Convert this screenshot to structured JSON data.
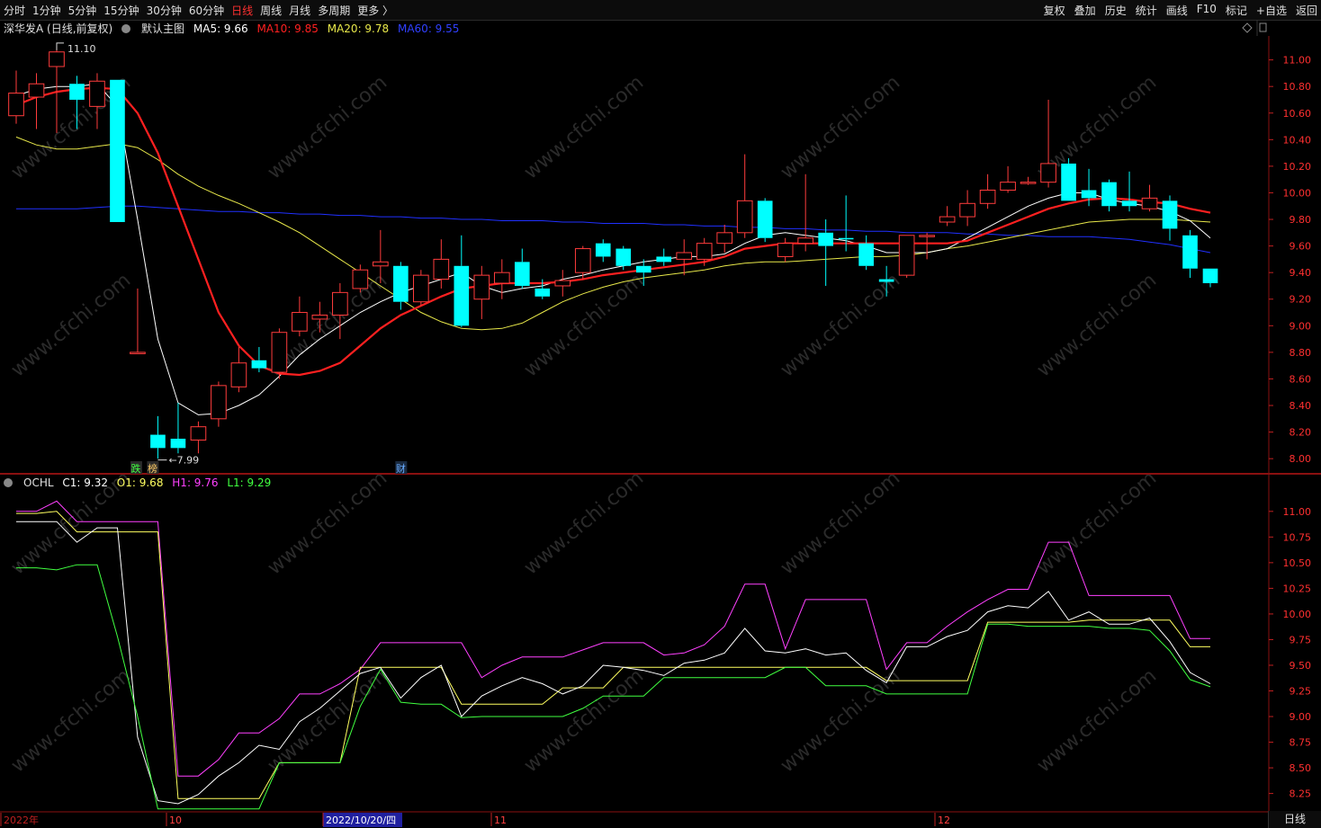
{
  "toolbar": {
    "left": [
      "分时",
      "1分钟",
      "5分钟",
      "15分钟",
      "30分钟",
      "60分钟",
      "日线",
      "周线",
      "月线",
      "多周期",
      "更多 〉"
    ],
    "active_index": 6,
    "right": [
      "复权",
      "叠加",
      "历史",
      "统计",
      "画线",
      "F10",
      "标记",
      "+自选",
      "返回"
    ]
  },
  "main_legend": {
    "stock": "深华发A (日线,前复权)",
    "template": "默认主图",
    "ma5": "MA5: 9.66",
    "ma10": "MA10: 9.85",
    "ma20": "MA20: 9.78",
    "ma60": "MA60: 9.55"
  },
  "sub_legend": {
    "name": "OCHL",
    "c1": "C1: 9.32",
    "o1": "O1: 9.68",
    "h1": "H1: 9.76",
    "l1": "L1: 9.29"
  },
  "bottom_right_label": "日线",
  "colors": {
    "up": "#ff3c3c",
    "down": "#00ffff",
    "ma5": "#ffffff",
    "ma10": "#ff2020",
    "ma20": "#e8e84a",
    "ma60": "#2030ff",
    "h1": "#ff40ff",
    "o1": "#ffff60",
    "c1": "#ffffff",
    "l1": "#40ff40",
    "axis": "#ff3030",
    "watermark": "#262626"
  },
  "watermark": "www.cfchi.com",
  "chart_data": [
    {
      "type": "candlestick",
      "title": "深华发A (日线,前复权)",
      "ylim": [
        7.92,
        11.18
      ],
      "y_ticks": [
        "11.00",
        "10.80",
        "10.60",
        "10.40",
        "10.20",
        "10.00",
        "9.80",
        "9.60",
        "9.40",
        "9.20",
        "9.00",
        "8.80",
        "8.60",
        "8.40",
        "8.20",
        "8.00"
      ],
      "max_marker": "11.10",
      "min_marker": "7.99",
      "event_tags": [
        "跌",
        "榜",
        "财"
      ],
      "candles": [
        {
          "o": 10.58,
          "c": 10.75,
          "h": 10.92,
          "l": 10.52
        },
        {
          "o": 10.72,
          "c": 10.82,
          "h": 10.9,
          "l": 10.48
        },
        {
          "o": 10.95,
          "c": 11.06,
          "h": 11.1,
          "l": 10.45
        },
        {
          "o": 10.82,
          "c": 10.7,
          "h": 10.88,
          "l": 10.48
        },
        {
          "o": 10.65,
          "c": 10.84,
          "h": 10.9,
          "l": 10.48
        },
        {
          "o": 10.85,
          "c": 9.78,
          "h": 10.85,
          "l": 9.78
        },
        {
          "o": 8.8,
          "c": 8.8,
          "h": 9.28,
          "l": 8.8
        },
        {
          "o": 8.18,
          "c": 8.08,
          "h": 8.32,
          "l": 8.0
        },
        {
          "o": 8.15,
          "c": 8.08,
          "h": 8.42,
          "l": 8.04
        },
        {
          "o": 8.14,
          "c": 8.24,
          "h": 8.28,
          "l": 8.04
        },
        {
          "o": 8.3,
          "c": 8.55,
          "h": 8.58,
          "l": 8.24
        },
        {
          "o": 8.54,
          "c": 8.72,
          "h": 8.84,
          "l": 8.5
        },
        {
          "o": 8.74,
          "c": 8.68,
          "h": 8.84,
          "l": 8.65
        },
        {
          "o": 8.65,
          "c": 8.95,
          "h": 8.98,
          "l": 8.6
        },
        {
          "o": 8.96,
          "c": 9.1,
          "h": 9.22,
          "l": 8.92
        },
        {
          "o": 9.05,
          "c": 9.08,
          "h": 9.18,
          "l": 8.95
        },
        {
          "o": 9.08,
          "c": 9.25,
          "h": 9.32,
          "l": 8.9
        },
        {
          "o": 9.28,
          "c": 9.42,
          "h": 9.46,
          "l": 9.25
        },
        {
          "o": 9.45,
          "c": 9.48,
          "h": 9.72,
          "l": 9.32
        },
        {
          "o": 9.45,
          "c": 9.18,
          "h": 9.48,
          "l": 9.12
        },
        {
          "o": 9.18,
          "c": 9.38,
          "h": 9.42,
          "l": 9.15
        },
        {
          "o": 9.35,
          "c": 9.5,
          "h": 9.65,
          "l": 9.28
        },
        {
          "o": 9.45,
          "c": 9.0,
          "h": 9.68,
          "l": 8.99
        },
        {
          "o": 9.2,
          "c": 9.38,
          "h": 9.45,
          "l": 9.05
        },
        {
          "o": 9.32,
          "c": 9.4,
          "h": 9.5,
          "l": 9.2
        },
        {
          "o": 9.48,
          "c": 9.3,
          "h": 9.58,
          "l": 9.28
        },
        {
          "o": 9.28,
          "c": 9.22,
          "h": 9.35,
          "l": 9.2
        },
        {
          "o": 9.3,
          "c": 9.34,
          "h": 9.42,
          "l": 9.22
        },
        {
          "o": 9.4,
          "c": 9.58,
          "h": 9.6,
          "l": 9.35
        },
        {
          "o": 9.62,
          "c": 9.52,
          "h": 9.65,
          "l": 9.48
        },
        {
          "o": 9.58,
          "c": 9.45,
          "h": 9.6,
          "l": 9.42
        },
        {
          "o": 9.45,
          "c": 9.4,
          "h": 9.5,
          "l": 9.3
        },
        {
          "o": 9.52,
          "c": 9.48,
          "h": 9.58,
          "l": 9.45
        },
        {
          "o": 9.5,
          "c": 9.55,
          "h": 9.65,
          "l": 9.38
        },
        {
          "o": 9.5,
          "c": 9.62,
          "h": 9.66,
          "l": 9.45
        },
        {
          "o": 9.62,
          "c": 9.7,
          "h": 9.76,
          "l": 9.55
        },
        {
          "o": 9.7,
          "c": 9.94,
          "h": 10.29,
          "l": 9.66
        },
        {
          "o": 9.94,
          "c": 9.66,
          "h": 9.96,
          "l": 9.63
        },
        {
          "o": 9.52,
          "c": 9.62,
          "h": 9.66,
          "l": 9.48
        },
        {
          "o": 9.62,
          "c": 9.66,
          "h": 10.14,
          "l": 9.56
        },
        {
          "o": 9.7,
          "c": 9.6,
          "h": 9.8,
          "l": 9.3
        },
        {
          "o": 9.66,
          "c": 9.65,
          "h": 9.98,
          "l": 9.56
        },
        {
          "o": 9.62,
          "c": 9.45,
          "h": 9.68,
          "l": 9.42
        },
        {
          "o": 9.35,
          "c": 9.33,
          "h": 9.45,
          "l": 9.22
        },
        {
          "o": 9.38,
          "c": 9.68,
          "h": 9.68,
          "l": 9.36
        },
        {
          "o": 9.67,
          "c": 9.68,
          "h": 9.7,
          "l": 9.5
        },
        {
          "o": 9.78,
          "c": 9.82,
          "h": 9.9,
          "l": 9.75
        },
        {
          "o": 9.82,
          "c": 9.92,
          "h": 10.02,
          "l": 9.75
        },
        {
          "o": 9.92,
          "c": 10.02,
          "h": 10.14,
          "l": 9.88
        },
        {
          "o": 10.02,
          "c": 10.08,
          "h": 10.2,
          "l": 10.0
        },
        {
          "o": 10.08,
          "c": 10.08,
          "h": 10.12,
          "l": 10.06
        },
        {
          "o": 10.08,
          "c": 10.22,
          "h": 10.7,
          "l": 10.04
        },
        {
          "o": 10.22,
          "c": 9.94,
          "h": 10.26,
          "l": 9.94
        },
        {
          "o": 10.02,
          "c": 9.96,
          "h": 10.18,
          "l": 9.9
        },
        {
          "o": 10.08,
          "c": 9.9,
          "h": 10.1,
          "l": 9.86
        },
        {
          "o": 9.94,
          "c": 9.9,
          "h": 10.16,
          "l": 9.86
        },
        {
          "o": 9.88,
          "c": 9.96,
          "h": 10.06,
          "l": 9.86
        },
        {
          "o": 9.94,
          "c": 9.73,
          "h": 9.98,
          "l": 9.64
        },
        {
          "o": 9.68,
          "c": 9.43,
          "h": 9.72,
          "l": 9.36
        },
        {
          "o": 9.43,
          "c": 9.32,
          "h": 9.43,
          "l": 9.29
        }
      ],
      "ma5": [
        10.73,
        10.78,
        10.8,
        10.8,
        10.82,
        10.65,
        9.8,
        8.9,
        8.42,
        8.33,
        8.34,
        8.4,
        8.48,
        8.62,
        8.78,
        8.9,
        9.0,
        9.1,
        9.18,
        9.25,
        9.3,
        9.35,
        9.4,
        9.3,
        9.25,
        9.28,
        9.3,
        9.35,
        9.38,
        9.42,
        9.45,
        9.48,
        9.5,
        9.52,
        9.52,
        9.54,
        9.62,
        9.68,
        9.7,
        9.68,
        9.66,
        9.64,
        9.6,
        9.55,
        9.55,
        9.55,
        9.58,
        9.66,
        9.74,
        9.82,
        9.9,
        9.96,
        10.0,
        10.0,
        9.95,
        9.92,
        9.9,
        9.86,
        9.79,
        9.66
      ],
      "ma10": [
        10.66,
        10.72,
        10.76,
        10.78,
        10.79,
        10.78,
        10.6,
        10.3,
        9.9,
        9.5,
        9.1,
        8.85,
        8.7,
        8.64,
        8.63,
        8.66,
        8.72,
        8.85,
        8.98,
        9.08,
        9.15,
        9.22,
        9.28,
        9.3,
        9.32,
        9.32,
        9.32,
        9.33,
        9.35,
        9.38,
        9.4,
        9.42,
        9.44,
        9.46,
        9.48,
        9.52,
        9.58,
        9.6,
        9.62,
        9.62,
        9.62,
        9.62,
        9.62,
        9.62,
        9.62,
        9.62,
        9.62,
        9.64,
        9.7,
        9.76,
        9.82,
        9.88,
        9.92,
        9.95,
        9.96,
        9.95,
        9.93,
        9.92,
        9.88,
        9.85
      ],
      "ma20": [
        10.42,
        10.36,
        10.33,
        10.33,
        10.35,
        10.37,
        10.34,
        10.25,
        10.14,
        10.05,
        9.98,
        9.92,
        9.85,
        9.78,
        9.7,
        9.6,
        9.5,
        9.4,
        9.3,
        9.2,
        9.1,
        9.03,
        8.98,
        8.97,
        8.98,
        9.02,
        9.1,
        9.18,
        9.24,
        9.29,
        9.33,
        9.36,
        9.38,
        9.4,
        9.42,
        9.45,
        9.47,
        9.48,
        9.48,
        9.49,
        9.5,
        9.51,
        9.52,
        9.52,
        9.53,
        9.55,
        9.58,
        9.6,
        9.63,
        9.66,
        9.69,
        9.72,
        9.75,
        9.78,
        9.79,
        9.8,
        9.8,
        9.8,
        9.79,
        9.78
      ],
      "ma60": [
        9.88,
        9.88,
        9.88,
        9.88,
        9.89,
        9.9,
        9.9,
        9.89,
        9.88,
        9.87,
        9.86,
        9.86,
        9.85,
        9.85,
        9.84,
        9.84,
        9.83,
        9.83,
        9.82,
        9.82,
        9.81,
        9.81,
        9.8,
        9.8,
        9.79,
        9.79,
        9.79,
        9.78,
        9.78,
        9.77,
        9.77,
        9.77,
        9.76,
        9.76,
        9.75,
        9.75,
        9.74,
        9.74,
        9.73,
        9.73,
        9.72,
        9.72,
        9.71,
        9.71,
        9.7,
        9.7,
        9.7,
        9.69,
        9.69,
        9.68,
        9.68,
        9.67,
        9.67,
        9.67,
        9.66,
        9.65,
        9.63,
        9.61,
        9.58,
        9.55
      ]
    },
    {
      "type": "line",
      "title": "OCHL",
      "ylim": [
        8.08,
        11.2
      ],
      "y_ticks": [
        "11.00",
        "10.75",
        "10.50",
        "10.25",
        "10.00",
        "9.75",
        "9.50",
        "9.25",
        "9.00",
        "8.75",
        "8.50",
        "8.25"
      ],
      "x_labels": [
        "2022年",
        "10",
        "2022/10/20/四",
        "11",
        "12"
      ],
      "series": [
        {
          "name": "H1",
          "values": [
            11.0,
            11.0,
            11.1,
            10.9,
            10.9,
            10.9,
            10.9,
            10.9,
            8.42,
            8.42,
            8.58,
            8.84,
            8.84,
            8.98,
            9.22,
            9.22,
            9.32,
            9.46,
            9.72,
            9.72,
            9.72,
            9.72,
            9.72,
            9.38,
            9.5,
            9.58,
            9.58,
            9.58,
            9.65,
            9.72,
            9.72,
            9.72,
            9.6,
            9.62,
            9.7,
            9.88,
            10.29,
            10.29,
            9.66,
            10.14,
            10.14,
            10.14,
            10.14,
            9.46,
            9.72,
            9.72,
            9.88,
            10.02,
            10.14,
            10.24,
            10.24,
            10.7,
            10.7,
            10.18,
            10.18,
            10.18,
            10.18,
            10.18,
            9.76,
            9.76
          ]
        },
        {
          "name": "O1",
          "values": [
            10.98,
            10.98,
            11.0,
            10.8,
            10.8,
            10.8,
            10.8,
            10.8,
            8.2,
            8.2,
            8.2,
            8.2,
            8.2,
            8.55,
            8.55,
            8.55,
            8.55,
            9.48,
            9.48,
            9.48,
            9.48,
            9.48,
            9.12,
            9.12,
            9.12,
            9.12,
            9.12,
            9.28,
            9.28,
            9.28,
            9.48,
            9.48,
            9.48,
            9.48,
            9.48,
            9.48,
            9.48,
            9.48,
            9.48,
            9.48,
            9.48,
            9.48,
            9.48,
            9.35,
            9.35,
            9.35,
            9.35,
            9.35,
            9.92,
            9.92,
            9.92,
            9.92,
            9.92,
            9.94,
            9.94,
            9.94,
            9.94,
            9.94,
            9.68,
            9.68
          ]
        },
        {
          "name": "C1",
          "values": [
            10.9,
            10.9,
            10.9,
            10.7,
            10.84,
            10.84,
            8.8,
            8.18,
            8.15,
            8.24,
            8.42,
            8.55,
            8.72,
            8.68,
            8.95,
            9.08,
            9.25,
            9.42,
            9.48,
            9.18,
            9.38,
            9.5,
            9.0,
            9.2,
            9.3,
            9.38,
            9.32,
            9.22,
            9.3,
            9.5,
            9.48,
            9.45,
            9.4,
            9.52,
            9.55,
            9.62,
            9.86,
            9.64,
            9.62,
            9.66,
            9.6,
            9.62,
            9.45,
            9.33,
            9.68,
            9.68,
            9.78,
            9.84,
            10.02,
            10.08,
            10.06,
            10.22,
            9.94,
            10.02,
            9.9,
            9.9,
            9.96,
            9.73,
            9.43,
            9.32
          ]
        },
        {
          "name": "L1",
          "values": [
            10.45,
            10.45,
            10.43,
            10.48,
            10.48,
            9.78,
            9.0,
            8.1,
            8.1,
            8.1,
            8.1,
            8.1,
            8.1,
            8.55,
            8.55,
            8.55,
            8.55,
            9.1,
            9.46,
            9.14,
            9.12,
            9.12,
            8.99,
            9.0,
            9.0,
            9.0,
            9.0,
            9.0,
            9.08,
            9.2,
            9.2,
            9.2,
            9.38,
            9.38,
            9.38,
            9.38,
            9.38,
            9.38,
            9.48,
            9.48,
            9.3,
            9.3,
            9.3,
            9.22,
            9.22,
            9.22,
            9.22,
            9.22,
            9.9,
            9.9,
            9.88,
            9.88,
            9.88,
            9.88,
            9.86,
            9.86,
            9.84,
            9.64,
            9.36,
            9.29
          ]
        }
      ]
    }
  ]
}
